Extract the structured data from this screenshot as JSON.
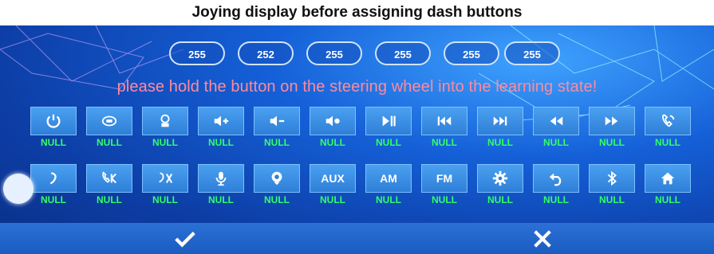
{
  "caption": "Joying display before assigning dash buttons",
  "values": [
    "255",
    "252",
    "255",
    "255",
    "255",
    "255"
  ],
  "prompt": "please hold the button on the steering wheel into the learning state!",
  "row1": [
    {
      "icon": "power-icon",
      "text": "",
      "label": "NULL"
    },
    {
      "icon": "phone-answer-icon",
      "text": "",
      "label": "NULL"
    },
    {
      "icon": "phone-hangup-icon",
      "text": "",
      "label": "NULL"
    },
    {
      "icon": "volume-up-icon",
      "text": "",
      "label": "NULL"
    },
    {
      "icon": "volume-down-icon",
      "text": "",
      "label": "NULL"
    },
    {
      "icon": "mute-icon",
      "text": "",
      "label": "NULL"
    },
    {
      "icon": "play-pause-icon",
      "text": "",
      "label": "NULL"
    },
    {
      "icon": "previous-track-icon",
      "text": "",
      "label": "NULL"
    },
    {
      "icon": "next-track-icon",
      "text": "",
      "label": "NULL"
    },
    {
      "icon": "rewind-icon",
      "text": "",
      "label": "NULL"
    },
    {
      "icon": "fast-forward-icon",
      "text": "",
      "label": "NULL"
    },
    {
      "icon": "call-icon",
      "text": "",
      "label": "NULL"
    }
  ],
  "row2": [
    {
      "icon": "hook-icon",
      "text": "",
      "label": "NULL"
    },
    {
      "icon": "call-k-icon",
      "text": "",
      "label": "NULL"
    },
    {
      "icon": "hook-x-icon",
      "text": "",
      "label": "NULL"
    },
    {
      "icon": "microphone-icon",
      "text": "",
      "label": "NULL"
    },
    {
      "icon": "navigation-icon",
      "text": "",
      "label": "NULL"
    },
    {
      "icon": "aux-icon",
      "text": "AUX",
      "label": "NULL"
    },
    {
      "icon": "am-icon",
      "text": "AM",
      "label": "NULL"
    },
    {
      "icon": "fm-icon",
      "text": "FM",
      "label": "NULL"
    },
    {
      "icon": "settings-gear-icon",
      "text": "",
      "label": "NULL"
    },
    {
      "icon": "back-icon",
      "text": "",
      "label": "NULL"
    },
    {
      "icon": "bluetooth-icon",
      "text": "",
      "label": "NULL"
    },
    {
      "icon": "home-icon",
      "text": "",
      "label": "NULL"
    }
  ],
  "confirm_icon": "checkmark-icon",
  "cancel_icon": "close-x-icon"
}
